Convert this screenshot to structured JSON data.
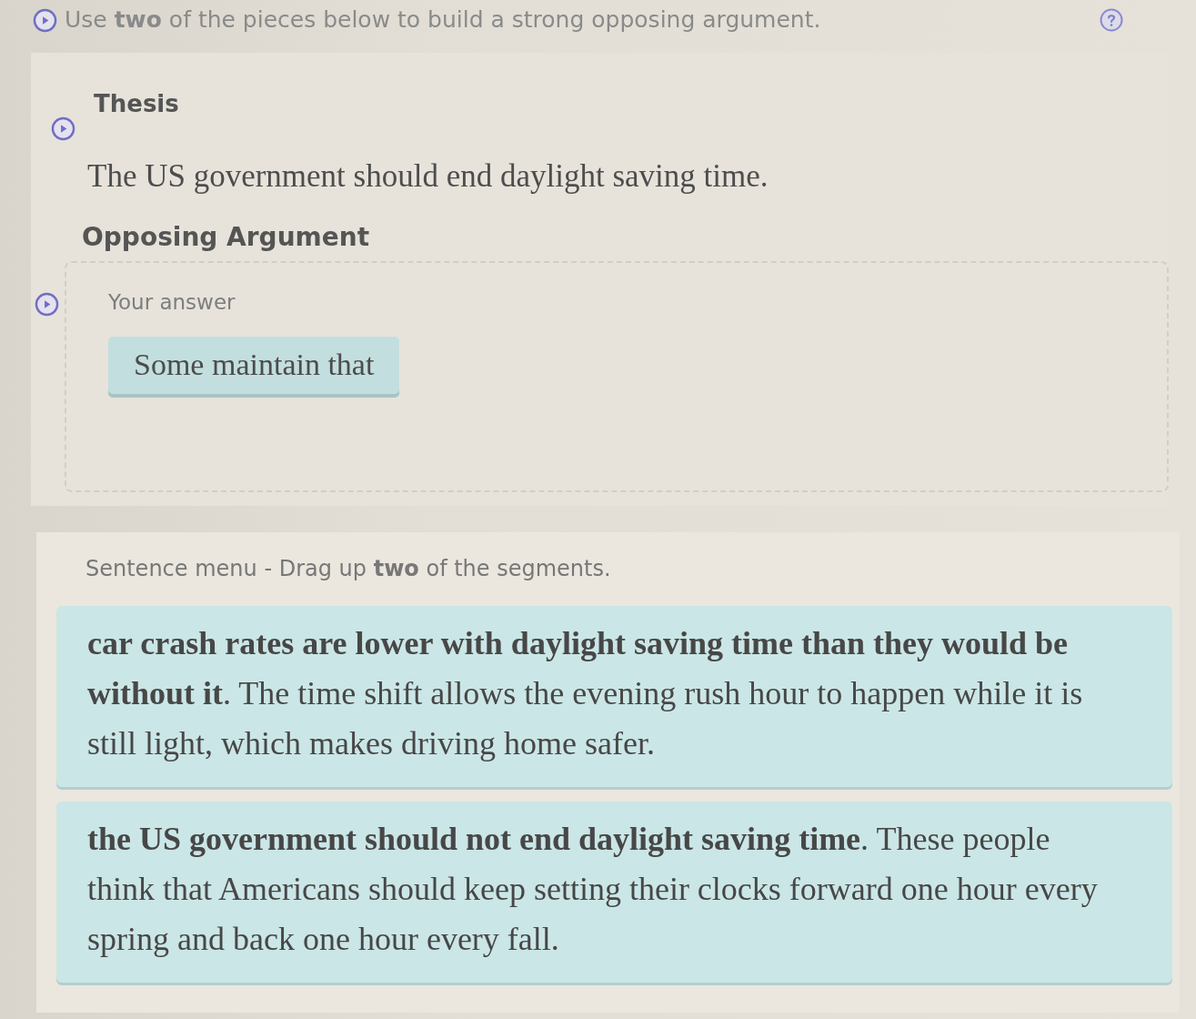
{
  "instruction": {
    "text": "Use **two** of the pieces below to build a strong opposing argument."
  },
  "thesis": {
    "label": "Thesis",
    "text": "The US government should end daylight saving time."
  },
  "opposing_argument": {
    "label": "Opposing Argument",
    "answer_box": {
      "placeholder": "Your answer",
      "pieces": [
        {
          "text": "Some maintain that"
        }
      ]
    }
  },
  "sentence_menu": {
    "prompt": "Sentence menu - Drag up **two** of the segments.",
    "segments": [
      {
        "text": "**car crash rates are lower with daylight saving time than they would be without it**. The time shift allows the evening rush hour to happen while it is still light, which makes driving home safer."
      },
      {
        "text": "**the US government should not end daylight saving time**. These people think that Americans should keep setting their clocks forward one hour every spring and back one hour every fall."
      }
    ]
  }
}
